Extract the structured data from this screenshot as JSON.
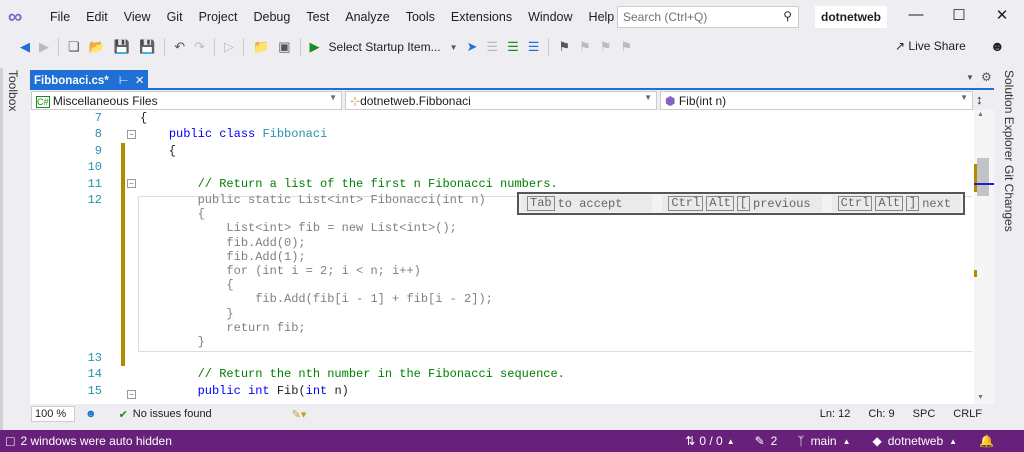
{
  "menu": {
    "items": [
      "File",
      "Edit",
      "View",
      "Git",
      "Project",
      "Debug",
      "Test",
      "Analyze",
      "Tools",
      "Extensions",
      "Window",
      "Help"
    ],
    "search_placeholder": "Search (Ctrl+Q)",
    "solution": "dotnetweb"
  },
  "toolbar": {
    "startup": "Select Startup Item...",
    "live_share": "Live Share"
  },
  "side": {
    "left": "Toolbox",
    "right1": "Solution Explorer",
    "right2": "Git Changes"
  },
  "tab": {
    "label": "Fibbonaci.cs*"
  },
  "nav": {
    "project": "Miscellaneous Files",
    "type": "dotnetweb.Fibbonaci",
    "member": "Fib(int n)"
  },
  "code": {
    "lines": [
      {
        "n": "7",
        "t": "{"
      },
      {
        "n": "8",
        "t": "    public class Fibbonaci"
      },
      {
        "n": "9",
        "t": "    {"
      },
      {
        "n": "10",
        "t": ""
      },
      {
        "n": "11",
        "t": "        // Return a list of the first n Fibonacci numbers."
      },
      {
        "n": "12",
        "t": ""
      }
    ],
    "ghost": [
      "        public static List<int> Fibonacci(int n)",
      "        {",
      "            List<int> fib = new List<int>();",
      "            fib.Add(0);",
      "            fib.Add(1);",
      "            for (int i = 2; i < n; i++)",
      "            {",
      "                fib.Add(fib[i - 1] + fib[i - 2]);",
      "            }",
      "            return fib;",
      "        }"
    ],
    "after": [
      {
        "n": "13",
        "t": ""
      },
      {
        "n": "14",
        "t": "        // Return the nth number in the Fibonacci sequence."
      },
      {
        "n": "15",
        "t": "        public int Fib(int n)"
      }
    ]
  },
  "hint": {
    "tab_key": "Tab",
    "accept": "to accept",
    "ctrl": "Ctrl",
    "alt": "Alt",
    "prev_key": "[",
    "previous": "previous",
    "next_key": "]",
    "next": "next"
  },
  "status": {
    "zoom": "100 %",
    "issues": "No issues found",
    "ln": "Ln: 12",
    "ch": "Ch: 9",
    "spc": "SPC",
    "crlf": "CRLF"
  },
  "bottom": {
    "msg": "2 windows were auto hidden",
    "sync": "0 / 0",
    "edits": "2",
    "branch": "main",
    "repo": "dotnetweb"
  },
  "colors": {
    "accent": "#1f6fd6",
    "statusbar": "#68217a",
    "change_marker": "#b38a00"
  }
}
